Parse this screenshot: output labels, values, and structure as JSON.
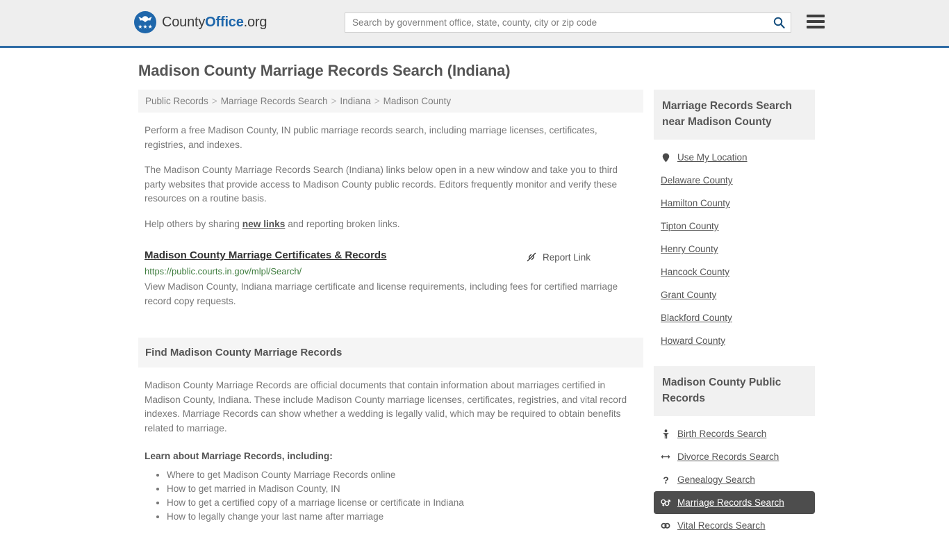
{
  "header": {
    "logo": {
      "part1": "County",
      "part2": "Office",
      "part3": ".org",
      "stars": "★★★"
    },
    "search": {
      "placeholder": "Search by government office, state, county, city or zip code",
      "value": "",
      "search_icon": "search-icon"
    },
    "menu_icon": "hamburger-menu-icon",
    "accent_color": "#2f6ca5"
  },
  "page": {
    "title": "Madison County Marriage Records Search (Indiana)"
  },
  "breadcrumb": {
    "separator": ">",
    "items": [
      "Public Records",
      "Marriage Records Search",
      "Indiana",
      "Madison County"
    ]
  },
  "intro": {
    "p1": "Perform a free Madison County, IN public marriage records search, including marriage licenses, certificates, registries, and indexes.",
    "p2": "The Madison County Marriage Records Search (Indiana) links below open in a new window and take you to third party websites that provide access to Madison County public records. Editors frequently monitor and verify these resources on a routine basis.",
    "p3_before": "Help others by sharing ",
    "p3_link": "new links",
    "p3_after": " and reporting broken links."
  },
  "result": {
    "title": "Madison County Marriage Certificates & Records",
    "report_label": "Report Link",
    "report_icon": "broken-link-icon",
    "url": "https://public.courts.in.gov/mlpl/Search/",
    "url_color": "#3f7d3f",
    "description": "View Madison County, Indiana marriage certificate and license requirements, including fees for certified marriage record copy requests."
  },
  "find_section": {
    "heading": "Find Madison County Marriage Records",
    "body": "Madison County Marriage Records are official documents that contain information about marriages certified in Madison County, Indiana. These include Madison County marriage licenses, certificates, registries, and vital record indexes. Marriage Records can show whether a wedding is legally valid, which may be required to obtain benefits related to marriage.",
    "learn_heading": "Learn about Marriage Records, including:",
    "learn_items": [
      "Where to get Madison County Marriage Records online",
      "How to get married in Madison County, IN",
      "How to get a certified copy of a marriage license or certificate in Indiana",
      "How to legally change your last name after marriage"
    ]
  },
  "sidebar": {
    "nearby": {
      "heading": "Marriage Records Search near Madison County",
      "items": [
        {
          "label": "Use My Location",
          "icon": "map-pin-icon"
        },
        {
          "label": "Delaware County",
          "icon": ""
        },
        {
          "label": "Hamilton County",
          "icon": ""
        },
        {
          "label": "Tipton County",
          "icon": ""
        },
        {
          "label": "Henry County",
          "icon": ""
        },
        {
          "label": "Hancock County",
          "icon": ""
        },
        {
          "label": "Grant County",
          "icon": ""
        },
        {
          "label": "Blackford County",
          "icon": ""
        },
        {
          "label": "Howard County",
          "icon": ""
        }
      ]
    },
    "public_records": {
      "heading": "Madison County Public Records",
      "highlight_color": "#4d4d4d",
      "items": [
        {
          "label": "Birth Records Search",
          "icon": "baby-icon",
          "active": false
        },
        {
          "label": "Divorce Records Search",
          "icon": "left-right-arrow-icon",
          "active": false
        },
        {
          "label": "Genealogy Search",
          "icon": "question-mark-icon",
          "active": false
        },
        {
          "label": "Marriage Records Search",
          "icon": "gender-symbols-icon",
          "active": true
        },
        {
          "label": "Vital Records Search",
          "icon": "rings-icon",
          "active": false
        }
      ]
    }
  }
}
